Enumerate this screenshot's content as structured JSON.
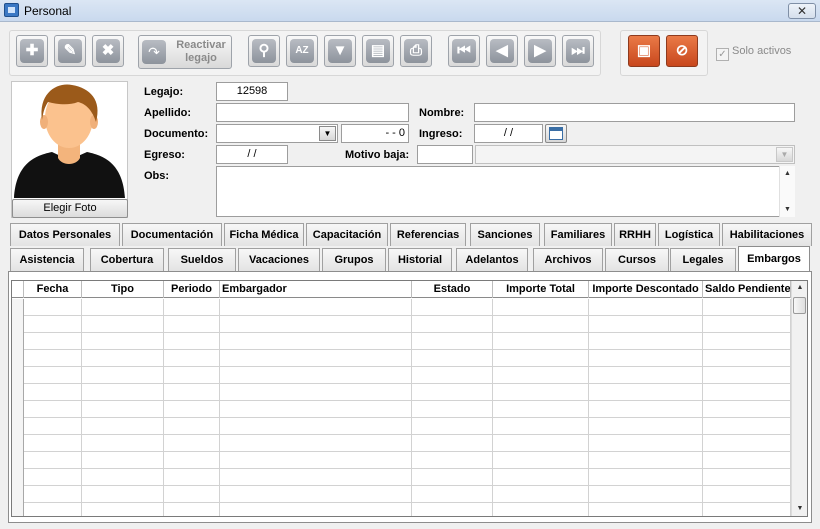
{
  "window": {
    "title": "Personal",
    "close_label": "✕"
  },
  "toolbar": {
    "reactivar_label": "Reactivar\nlegajo",
    "solo_activos_label": "Solo activos",
    "solo_activos_checked": true
  },
  "photo": {
    "button_label": "Elegir Foto"
  },
  "form": {
    "legajo_label": "Legajo:",
    "legajo_value": "12598",
    "apellido_label": "Apellido:",
    "apellido_value": "",
    "nombre_label": "Nombre:",
    "nombre_value": "",
    "documento_label": "Documento:",
    "documento_type_value": "",
    "documento_number_value": "-  -  0",
    "ingreso_label": "Ingreso:",
    "ingreso_value": "/ /",
    "egreso_label": "Egreso:",
    "egreso_value": "/ /",
    "motivo_label": "Motivo baja:",
    "motivo_code_value": "",
    "motivo_value": "",
    "obs_label": "Obs:",
    "obs_value": ""
  },
  "tabs_row1": [
    "Datos Personales",
    "Documentación",
    "Ficha Médica",
    "Capacitación",
    "Referencias",
    "Sanciones",
    "Familiares",
    "RRHH",
    "Logística",
    "Habilitaciones"
  ],
  "tabs_row2": [
    "Asistencia",
    "Cobertura",
    "Sueldos",
    "Vacaciones",
    "Grupos",
    "Historial",
    "Adelantos",
    "Archivos",
    "Cursos",
    "Legales",
    "Embargos"
  ],
  "active_tab": "Embargos",
  "grid": {
    "columns": [
      "Fecha",
      "Tipo",
      "Periodo",
      "Embargador",
      "Estado",
      "Importe Total",
      "Importe Descontado",
      "Saldo Pendiente"
    ],
    "rows": []
  }
}
